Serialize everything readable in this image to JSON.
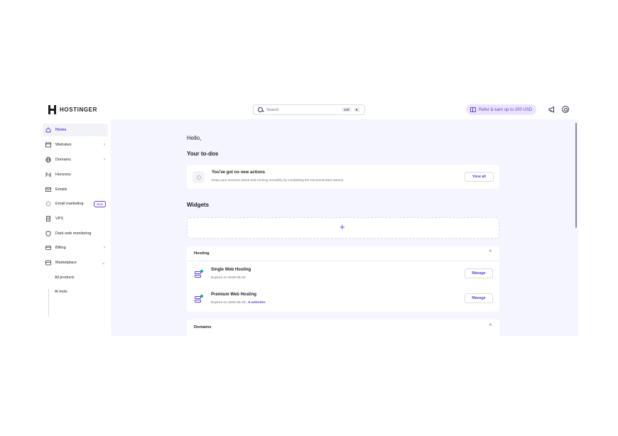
{
  "header": {
    "logo_text": "HOSTINGER",
    "search_placeholder": "Search",
    "search_kbd_1": "Ctrl",
    "search_kbd_2": "K",
    "refer_label": "Refer & earn up to 200 USD"
  },
  "sidebar": {
    "items": [
      {
        "label": "Home"
      },
      {
        "label": "Websites"
      },
      {
        "label": "Domains"
      },
      {
        "label": "Horizons"
      },
      {
        "label": "Emails"
      },
      {
        "label": "Email marketing",
        "badge": "New"
      },
      {
        "label": "VPS"
      },
      {
        "label": "Dark web monitoring"
      },
      {
        "label": "Billing"
      },
      {
        "label": "Marketplace"
      }
    ],
    "sub_items": [
      {
        "label": "All products"
      },
      {
        "label": "AI tools"
      }
    ]
  },
  "main": {
    "greeting": "Hello,",
    "todos_heading": "Your to-dos",
    "todo_title": "You've got no new actions",
    "todo_desc": "Keep your services active and running smoothly by completing the recommended actions",
    "view_all": "View all",
    "widgets_heading": "Widgets",
    "plus": "+",
    "hosting": {
      "title": "Hosting",
      "caret": "^",
      "items": [
        {
          "name": "Single Web Hosting",
          "expires": "Expires on 2026-08-03",
          "manage": "Manage"
        },
        {
          "name": "Premium Web Hosting",
          "expires": "Expires on 2025-08-28",
          "websites": "8 websites",
          "manage": "Manage"
        }
      ]
    },
    "domains": {
      "title": "Domains",
      "caret": "^"
    }
  },
  "colors": {
    "accent": "#673de6",
    "content_bg": "#f4f5ff",
    "refer_bg": "#ebe4ff",
    "status_dot": "#00b090"
  }
}
